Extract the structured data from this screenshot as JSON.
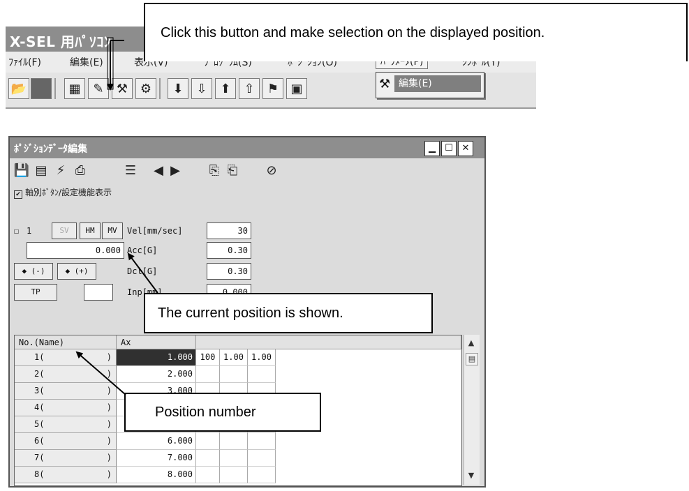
{
  "top_app": {
    "title": "X-SEL 用ﾊﾟｿｺﾝ",
    "menu": [
      "ﾌｧｲﾙ(F)",
      "編集(E)",
      "表示(V)",
      "ﾌﾟﾛｸﾞﾗﾑ(S)",
      "ﾎﾟｼﾞｼｮﾝ(O)",
      "ﾊﾟﾗﾒｰﾀ(P)",
      "ｼﾝﾎﾞﾙ(Y)"
    ],
    "dropdown_item": "編集(E)"
  },
  "callouts": {
    "top": "Click this button and make selection on the displayed position.",
    "current_position": "The current position is shown.",
    "position_number": "Position number"
  },
  "pos_window": {
    "title": "ﾎﾟｼﾞｼｮﾝﾃﾞｰﾀ編集",
    "checkbox_label": "軸別ﾎﾞﾀﾝ/設定機能表示",
    "axis_number": "1",
    "buttons": {
      "sv": "SV",
      "hm": "HM",
      "mv": "MV",
      "jog_minus": "◆ (-)",
      "jog_plus": "◆ (+)",
      "tp": "TP"
    },
    "current_position": "0.000",
    "params": [
      {
        "label": "Vel[mm/sec]",
        "value": "30"
      },
      {
        "label": "Acc[G]",
        "value": "0.30"
      },
      {
        "label": "Dcl[G]",
        "value": "0.30"
      },
      {
        "label": "Inp[mm]",
        "value": "0.000"
      }
    ],
    "grid": {
      "header_name": "No.(Name)",
      "header_axis": "Ax",
      "rows": [
        {
          "no": "1(",
          "value": "1.000",
          "c1": "100",
          "c2": "1.00",
          "c3": "1.00"
        },
        {
          "no": "2(",
          "value": "2.000",
          "c1": "",
          "c2": "",
          "c3": ""
        },
        {
          "no": "3(",
          "value": "3.000",
          "c1": "",
          "c2": "",
          "c3": ""
        },
        {
          "no": "4(",
          "value": "",
          "c1": "",
          "c2": "",
          "c3": ""
        },
        {
          "no": "5(",
          "value": "",
          "c1": "",
          "c2": "",
          "c3": ""
        },
        {
          "no": "6(",
          "value": "6.000",
          "c1": "",
          "c2": "",
          "c3": ""
        },
        {
          "no": "7(",
          "value": "7.000",
          "c1": "",
          "c2": "",
          "c3": ""
        },
        {
          "no": "8(",
          "value": "8.000",
          "c1": "",
          "c2": "",
          "c3": ""
        }
      ]
    }
  }
}
